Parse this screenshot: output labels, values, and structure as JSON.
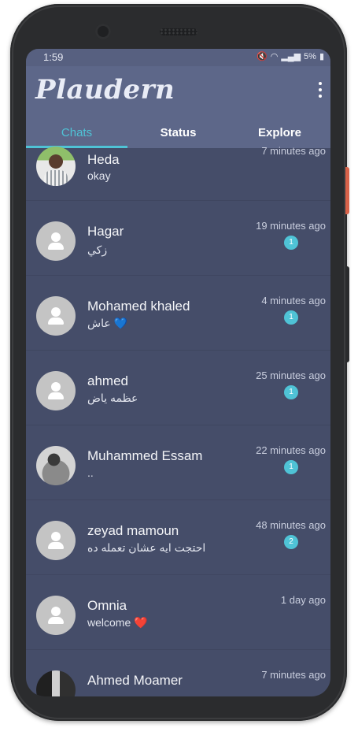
{
  "status_bar": {
    "time": "1:59",
    "battery": "5%",
    "icons": [
      "mute-icon",
      "wifi-icon",
      "signal-icon",
      "battery-icon"
    ]
  },
  "app": {
    "title": "Plaudern",
    "accent_color": "#4fc3d6",
    "bar_color": "#5d6789",
    "list_background": "#454d69"
  },
  "tabs": [
    {
      "label": "Chats",
      "active": true
    },
    {
      "label": "Status",
      "active": false
    },
    {
      "label": "Explore",
      "active": false
    }
  ],
  "chats": [
    {
      "name": "Heda",
      "message": "okay",
      "time": "7 minutes ago",
      "unread": "",
      "avatar": "photo"
    },
    {
      "name": "Hagar",
      "message": "زكي",
      "time": "19 minutes ago",
      "unread": "1",
      "avatar": "placeholder"
    },
    {
      "name": "Mohamed khaled",
      "message": "عاش 💙",
      "time": "4 minutes ago",
      "unread": "1",
      "avatar": "placeholder"
    },
    {
      "name": "ahmed",
      "message": "عظمه ياض",
      "time": "25 minutes ago",
      "unread": "1",
      "avatar": "placeholder"
    },
    {
      "name": "Muhammed Essam",
      "message": "..",
      "time": "22 minutes ago",
      "unread": "1",
      "avatar": "photo"
    },
    {
      "name": "zeyad mamoun",
      "message": "احتجت ايه عشان تعمله ده",
      "time": "48 minutes ago",
      "unread": "2",
      "avatar": "placeholder"
    },
    {
      "name": "Omnia",
      "message": "welcome ❤️",
      "time": "1 day ago",
      "unread": "",
      "avatar": "placeholder"
    },
    {
      "name": "Ahmed Moamer",
      "message": "",
      "time": "7 minutes ago",
      "unread": "",
      "avatar": "photo"
    }
  ]
}
